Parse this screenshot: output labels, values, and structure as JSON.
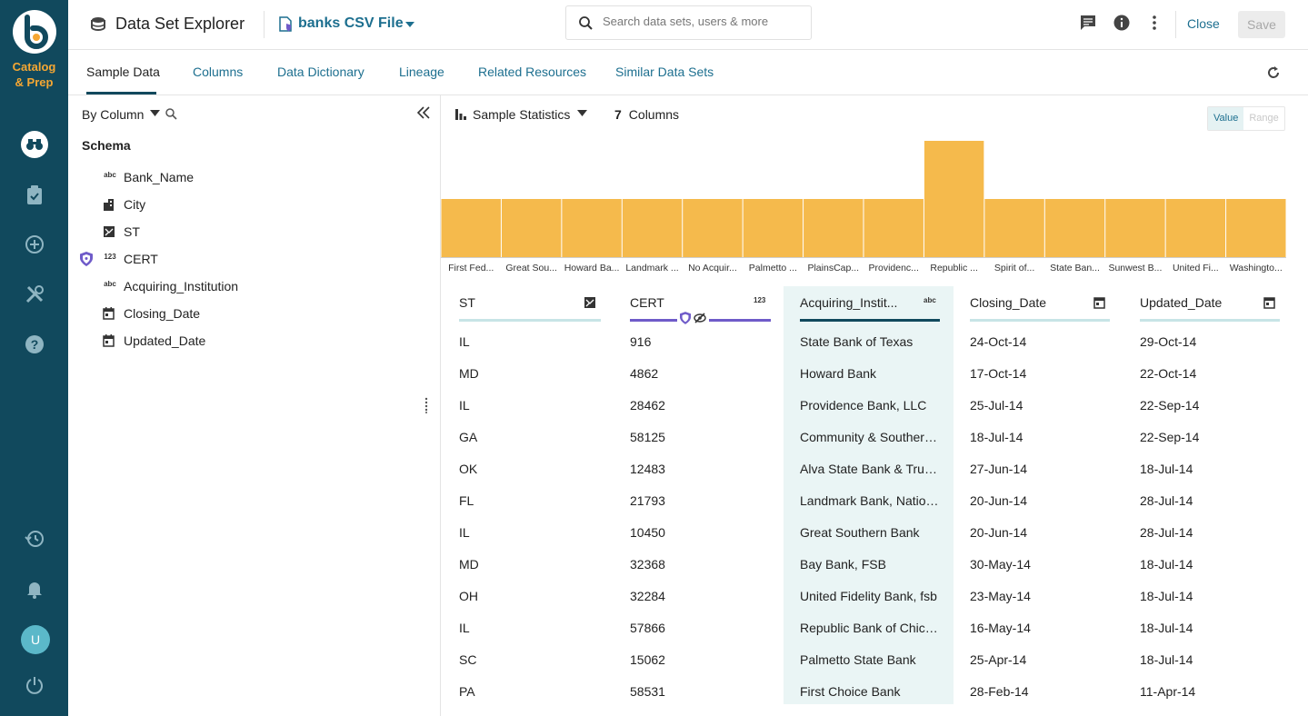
{
  "brand": {
    "name_line1": "Catalog",
    "name_line2": "& Prep",
    "logo_letter": "b"
  },
  "rail": {
    "icons": [
      "binoculars-icon",
      "clipboard-check-icon",
      "plus-circle-icon",
      "tools-icon",
      "help-icon",
      "history-icon",
      "bell-icon",
      "avatar",
      "power-icon"
    ],
    "avatar_initial": "U"
  },
  "header": {
    "title": "Data Set Explorer",
    "file_name": "banks CSV File",
    "search_placeholder": "Search data sets, users & more",
    "close_label": "Close",
    "save_label": "Save"
  },
  "tabs": [
    {
      "label": "Sample Data",
      "active": true
    },
    {
      "label": "Columns"
    },
    {
      "label": "Data Dictionary"
    },
    {
      "label": "Lineage"
    },
    {
      "label": "Related Resources"
    },
    {
      "label": "Similar Data Sets"
    }
  ],
  "left_panel": {
    "group_by": "By Column",
    "schema_title": "Schema",
    "schema": [
      {
        "name": "Bank_Name",
        "type_icon": "abc",
        "protected": false
      },
      {
        "name": "City",
        "type_icon": "city-icon",
        "protected": false
      },
      {
        "name": "ST",
        "type_icon": "map-icon",
        "protected": false
      },
      {
        "name": "CERT",
        "type_icon": "123",
        "protected": true
      },
      {
        "name": "Acquiring_Institution",
        "type_icon": "abc",
        "protected": false
      },
      {
        "name": "Closing_Date",
        "type_icon": "calendar-icon",
        "protected": false
      },
      {
        "name": "Updated_Date",
        "type_icon": "calendar-icon",
        "protected": false
      }
    ]
  },
  "stats": {
    "label": "Sample Statistics",
    "column_count": "7",
    "column_count_label": "Columns",
    "toggle_value": "Value",
    "toggle_range": "Range"
  },
  "chart_data": {
    "type": "bar",
    "categories": [
      "First Fed...",
      "Great Sou...",
      "Howard Ba...",
      "Landmark ...",
      "No Acquir...",
      "Palmetto ...",
      "PlainsCap...",
      "Providenc...",
      "Republic ...",
      "Spirit of...",
      "State Ban...",
      "Sunwest B...",
      "United Fi...",
      "Washingto..."
    ],
    "values": [
      1,
      1,
      1,
      1,
      1,
      1,
      1,
      1,
      2,
      1,
      1,
      1,
      1,
      1
    ],
    "ylim": [
      0,
      2
    ],
    "bar_color": "#f5ba4c",
    "grid": false
  },
  "table": {
    "columns": [
      {
        "label": "ST",
        "type_icon": "map-icon",
        "underline": "#c7e4e6"
      },
      {
        "label": "CERT",
        "type_icon": "123",
        "underline": "#6f5bc9",
        "protected": true
      },
      {
        "label": "Acquiring_Instit...",
        "type_icon": "abc",
        "underline": "#11495d",
        "highlighted": true
      },
      {
        "label": "Closing_Date",
        "type_icon": "calendar-icon",
        "underline": "#c7e4e6"
      },
      {
        "label": "Updated_Date",
        "type_icon": "calendar-icon",
        "underline": "#c7e4e6"
      }
    ],
    "rows": [
      [
        "IL",
        "916",
        "State Bank of Texas",
        "24-Oct-14",
        "29-Oct-14"
      ],
      [
        "MD",
        "4862",
        "Howard Bank",
        "17-Oct-14",
        "22-Oct-14"
      ],
      [
        "IL",
        "28462",
        "Providence Bank, LLC",
        "25-Jul-14",
        "22-Sep-14"
      ],
      [
        "GA",
        "58125",
        "Community & Southern...",
        "18-Jul-14",
        "22-Sep-14"
      ],
      [
        "OK",
        "12483",
        "Alva State Bank & Trust...",
        "27-Jun-14",
        "18-Jul-14"
      ],
      [
        "FL",
        "21793",
        "Landmark Bank, Nation...",
        "20-Jun-14",
        "28-Jul-14"
      ],
      [
        "IL",
        "10450",
        "Great Southern Bank",
        "20-Jun-14",
        "28-Jul-14"
      ],
      [
        "MD",
        "32368",
        "Bay Bank, FSB",
        "30-May-14",
        "18-Jul-14"
      ],
      [
        "OH",
        "32284",
        "United Fidelity Bank, fsb",
        "23-May-14",
        "18-Jul-14"
      ],
      [
        "IL",
        "57866",
        "Republic Bank of Chica...",
        "16-May-14",
        "18-Jul-14"
      ],
      [
        "SC",
        "15062",
        "Palmetto State Bank",
        "25-Apr-14",
        "18-Jul-14"
      ],
      [
        "PA",
        "58531",
        "First Choice Bank",
        "28-Feb-14",
        "11-Apr-14"
      ]
    ]
  },
  "colors": {
    "rail": "#11495d",
    "accent": "#1d6f8f",
    "brand_orange": "#f5a733",
    "protected": "#6f5bc9"
  }
}
